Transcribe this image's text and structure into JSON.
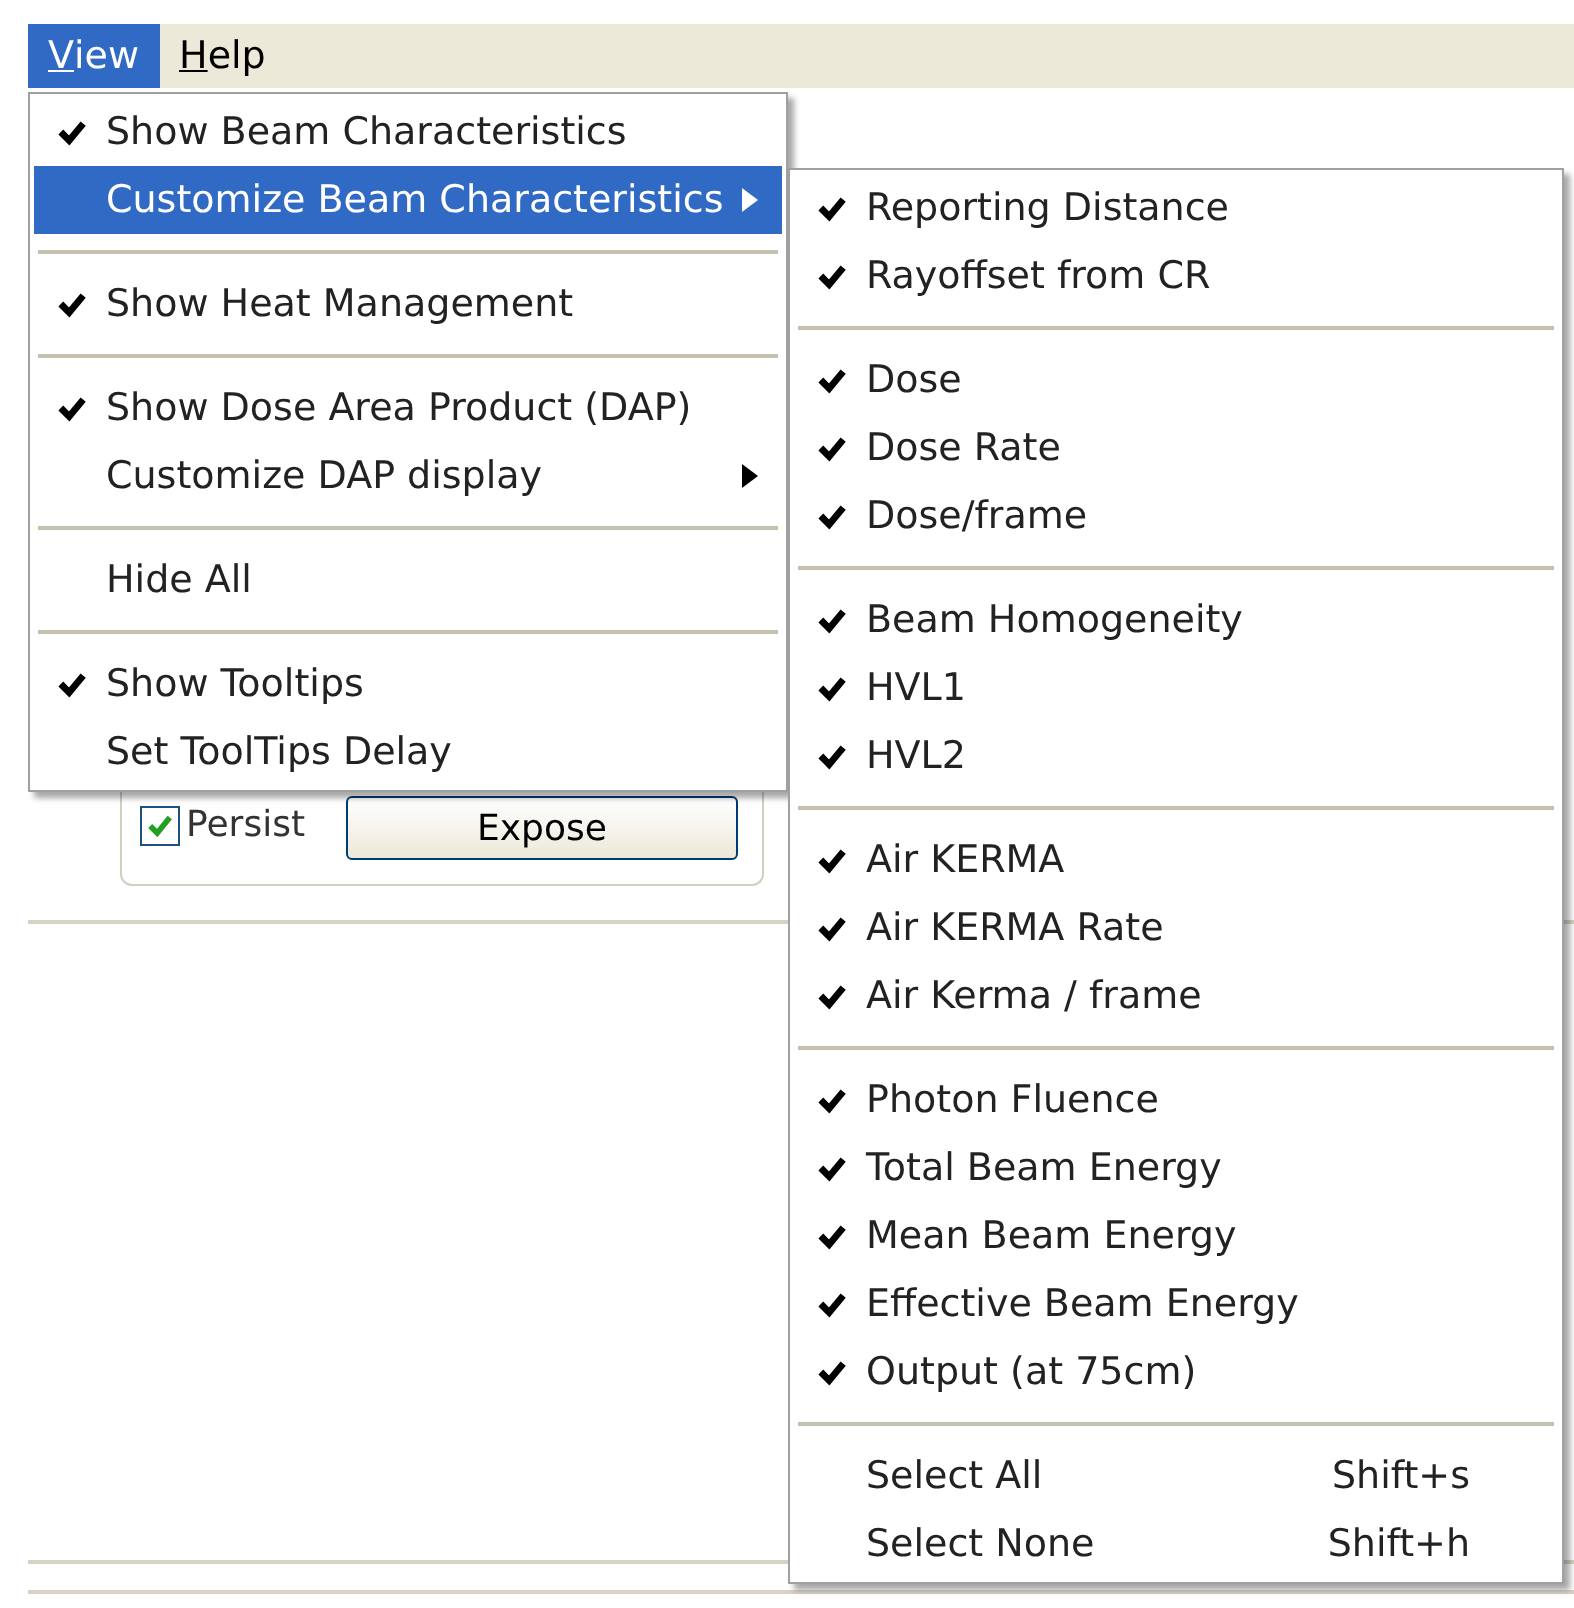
{
  "menubar": [
    {
      "label": "View",
      "selected": true
    },
    {
      "label": "Help",
      "selected": false
    }
  ],
  "background": {
    "persist": {
      "label": "Persist",
      "checked": true
    },
    "expose_button": "Expose"
  },
  "view_menu": [
    {
      "kind": "item",
      "label": "Show Beam Characteristics",
      "checked": true,
      "selected": false
    },
    {
      "kind": "submenu",
      "label": "Customize Beam Characteristics",
      "checked": false,
      "selected": true
    },
    {
      "kind": "separator"
    },
    {
      "kind": "item",
      "label": "Show Heat Management",
      "checked": true,
      "selected": false
    },
    {
      "kind": "separator"
    },
    {
      "kind": "item",
      "label": "Show Dose Area Product (DAP)",
      "checked": true,
      "selected": false
    },
    {
      "kind": "submenu",
      "label": "Customize DAP display",
      "checked": false,
      "selected": false
    },
    {
      "kind": "separator"
    },
    {
      "kind": "item",
      "label": "Hide All",
      "checked": false,
      "selected": false
    },
    {
      "kind": "separator"
    },
    {
      "kind": "item",
      "label": "Show Tooltips",
      "checked": true,
      "selected": false
    },
    {
      "kind": "item",
      "label": "Set ToolTips Delay",
      "checked": false,
      "selected": false
    }
  ],
  "submenu": [
    {
      "kind": "item",
      "label": "Reporting Distance",
      "checked": true
    },
    {
      "kind": "item",
      "label": "Rayoffset from CR",
      "checked": true
    },
    {
      "kind": "separator"
    },
    {
      "kind": "item",
      "label": "Dose",
      "checked": true
    },
    {
      "kind": "item",
      "label": "Dose Rate",
      "checked": true
    },
    {
      "kind": "item",
      "label": "Dose/frame",
      "checked": true
    },
    {
      "kind": "separator"
    },
    {
      "kind": "item",
      "label": "Beam Homogeneity",
      "checked": true
    },
    {
      "kind": "item",
      "label": "HVL1",
      "checked": true
    },
    {
      "kind": "item",
      "label": "HVL2",
      "checked": true
    },
    {
      "kind": "separator"
    },
    {
      "kind": "item",
      "label": "Air KERMA",
      "checked": true
    },
    {
      "kind": "item",
      "label": "Air KERMA Rate",
      "checked": true
    },
    {
      "kind": "item",
      "label": "Air Kerma / frame",
      "checked": true
    },
    {
      "kind": "separator"
    },
    {
      "kind": "item",
      "label": "Photon Fluence",
      "checked": true
    },
    {
      "kind": "item",
      "label": "Total Beam Energy",
      "checked": true
    },
    {
      "kind": "item",
      "label": "Mean Beam Energy",
      "checked": true
    },
    {
      "kind": "item",
      "label": "Effective Beam Energy",
      "checked": true
    },
    {
      "kind": "item",
      "label": "Output (at 75cm)",
      "checked": true
    },
    {
      "kind": "separator"
    },
    {
      "kind": "item",
      "label": "Select All",
      "checked": false,
      "shortcut": "Shift+s"
    },
    {
      "kind": "item",
      "label": "Select None",
      "checked": false,
      "shortcut": "Shift+h"
    }
  ]
}
